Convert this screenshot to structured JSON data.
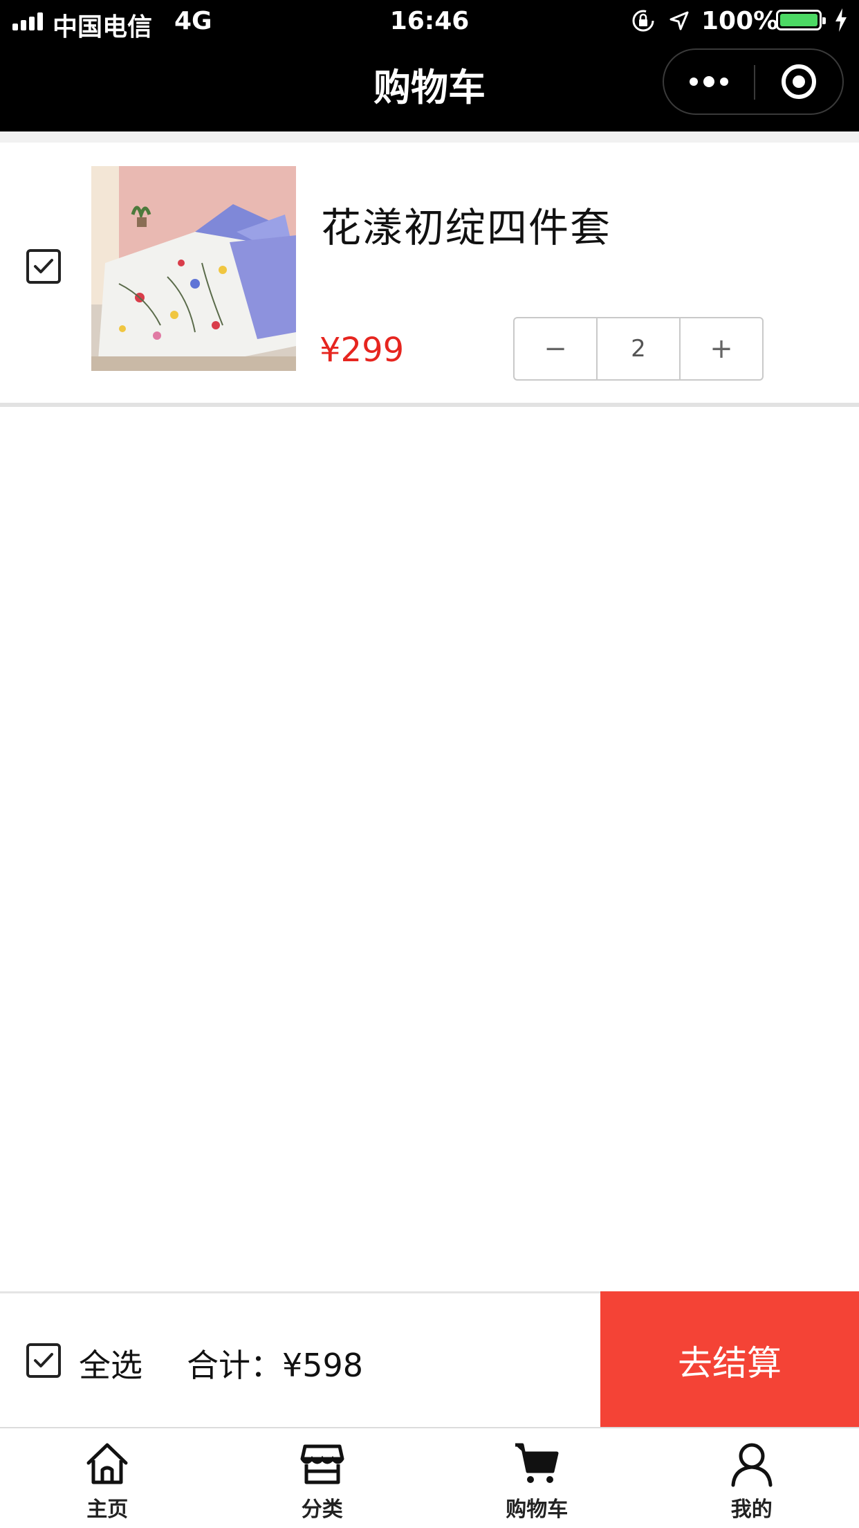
{
  "status_bar": {
    "carrier": "中国电信",
    "network": "4G",
    "time": "16:46",
    "battery_percent": "100%",
    "battery_level": 1.0,
    "battery_color": "#4cd964"
  },
  "nav": {
    "title": "购物车",
    "more_icon": "more-dots-icon",
    "close_icon": "target-close-icon"
  },
  "cart": {
    "items": [
      {
        "checked": true,
        "name": "花漾初绽四件套",
        "price": "¥299",
        "quantity": "2",
        "minus_label": "−",
        "plus_label": "+"
      }
    ]
  },
  "checkout": {
    "select_all_label": "全选",
    "total_label": "合计：¥598",
    "button_label": "去结算",
    "button_color": "#f44336",
    "price_color": "#e6251f"
  },
  "tabbar": {
    "tabs": [
      {
        "label": "主页",
        "icon": "home-icon"
      },
      {
        "label": "分类",
        "icon": "store-icon"
      },
      {
        "label": "购物车",
        "icon": "cart-icon"
      },
      {
        "label": "我的",
        "icon": "user-icon"
      }
    ]
  }
}
